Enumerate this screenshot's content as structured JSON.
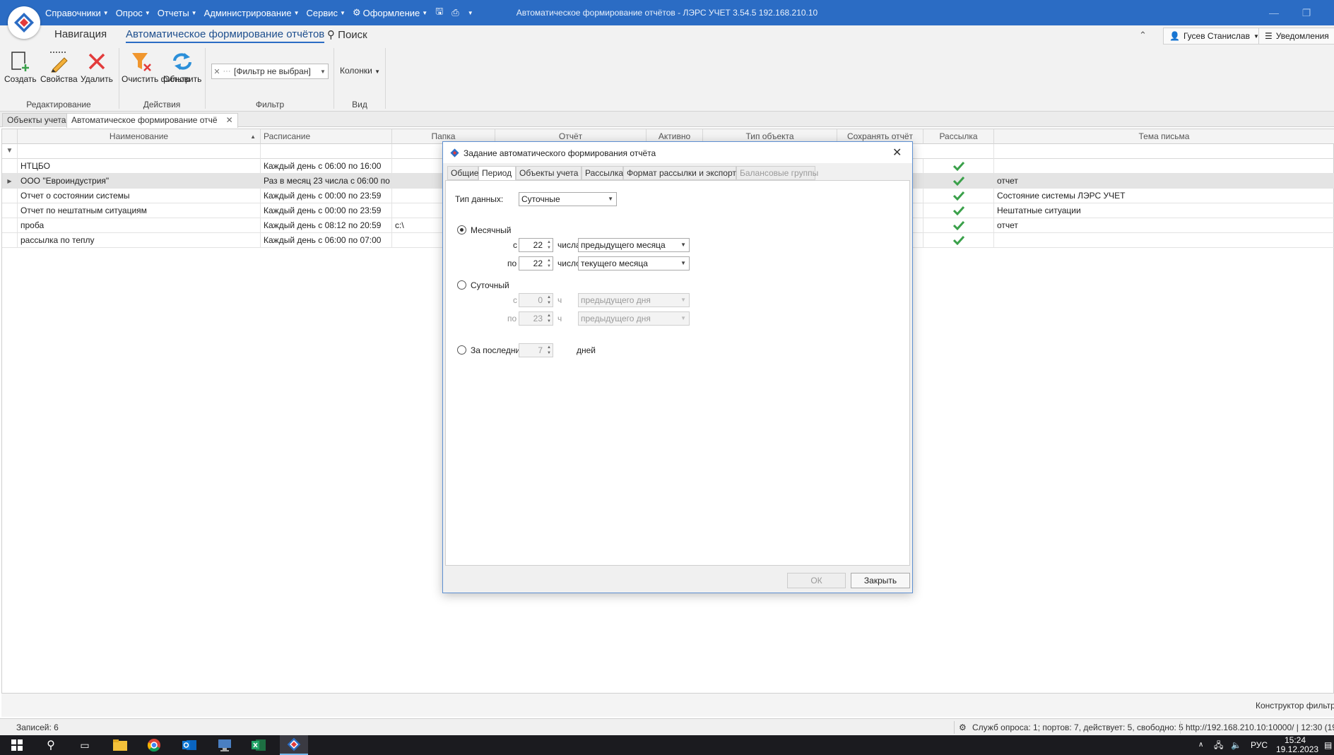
{
  "window": {
    "title": "Автоматическое формирование отчётов - ЛЭРС УЧЕТ 3.54.5 192.168.210.10",
    "minimize_icon": "minimize-icon",
    "maximize_icon": "maximize-icon",
    "close_icon": "close-icon"
  },
  "menu": {
    "items": [
      {
        "label": "Справочники"
      },
      {
        "label": "Опрос"
      },
      {
        "label": "Отчеты"
      },
      {
        "label": "Администрирование"
      },
      {
        "label": "Сервис"
      },
      {
        "label": "Оформление"
      }
    ]
  },
  "ribbon": {
    "tabs": [
      {
        "label": "Навигация"
      },
      {
        "label": "Автоматическое формирование отчётов"
      }
    ],
    "search_label": "Поиск",
    "buttons": {
      "create": "Создать",
      "properties": "Свойства",
      "delete": "Удалить",
      "clear_filter": "Очистить фильтр",
      "refresh": "Обновить"
    },
    "groups": {
      "edit": "Редактирование",
      "actions": "Действия",
      "filter": "Фильтр",
      "view": "Вид"
    },
    "filter_value": "[Фильтр не выбран]",
    "columns_label": "Колонки",
    "user_name": "Гусев Станислав",
    "notifications_label": "Уведомления"
  },
  "doc_tabs": [
    {
      "label": "Объекты учета"
    },
    {
      "label": "Автоматическое формирование отчё"
    }
  ],
  "grid": {
    "columns": [
      "Наименование",
      "Расписание",
      "Папка",
      "Отчёт",
      "Активно",
      "Тип объекта",
      "Сохранять отчёт",
      "Рассылка",
      "Тема письма"
    ],
    "rows": [
      {
        "name": "НТЦБО",
        "schedule": "Каждый день с 06:00 по 16:00",
        "folder": "",
        "mailing": true,
        "subject": ""
      },
      {
        "name": "ООО \"Евроиндустрия\"",
        "schedule": "Раз в месяц 23 числа с 06:00 по 0...",
        "folder": "",
        "mailing": true,
        "subject": "отчет"
      },
      {
        "name": "Отчет о состоянии системы",
        "schedule": "Каждый день с 00:00 по 23:59",
        "folder": "",
        "mailing": true,
        "subject": "Состояние системы ЛЭРС УЧЕТ"
      },
      {
        "name": "Отчет по нештатным ситуациям",
        "schedule": "Каждый день с 00:00 по 23:59",
        "folder": "",
        "mailing": true,
        "subject": "Нештатные ситуации"
      },
      {
        "name": "проба",
        "schedule": "Каждый день с 08:12 по 20:59",
        "folder": "c:\\",
        "mailing": true,
        "subject": "отчет"
      },
      {
        "name": "рассылка по теплу",
        "schedule": "Каждый день с 06:00 по 07:00",
        "folder": "",
        "mailing": true,
        "subject": ""
      }
    ],
    "constructor_label": "Конструктор фильтра"
  },
  "dialog": {
    "title": "Задание автоматического формирования отчёта",
    "tabs": [
      {
        "label": "Общие"
      },
      {
        "label": "Период"
      },
      {
        "label": "Объекты учета"
      },
      {
        "label": "Рассылка"
      },
      {
        "label": "Формат рассылки и экспорта"
      },
      {
        "label": "Балансовые группы"
      }
    ],
    "data_type_label": "Тип данных:",
    "data_type_value": "Суточные",
    "monthly": {
      "label": "Месячный",
      "from_prefix": "с",
      "from_day": "22",
      "from_unit": "числа",
      "from_month": "предыдущего месяца",
      "to_prefix": "по",
      "to_day": "22",
      "to_unit": "число",
      "to_month": "текущего месяца"
    },
    "daily": {
      "label": "Суточный",
      "from_prefix": "с",
      "from_hour": "0",
      "from_unit": "ч",
      "from_day": "предыдущего дня",
      "to_prefix": "по",
      "to_hour": "23",
      "to_unit": "ч",
      "to_day": "предыдущего дня"
    },
    "last": {
      "label": "За последние",
      "value": "7",
      "unit": "дней"
    },
    "ok_label": "ОК",
    "close_label": "Закрыть"
  },
  "statusbar": {
    "records": "Записей: 6",
    "services": "Служб опроса: 1; портов: 7, действует: 5, свободно: 5",
    "server": "http://192.168.210.10:10000/ | 12:30 (19"
  },
  "taskbar": {
    "lang": "РУС",
    "time": "15:24",
    "date": "19.12.2023"
  },
  "colors": {
    "titlebar": "#2b6cc4",
    "check_green": "#3aa04a",
    "delete_red": "#e23b3b"
  }
}
